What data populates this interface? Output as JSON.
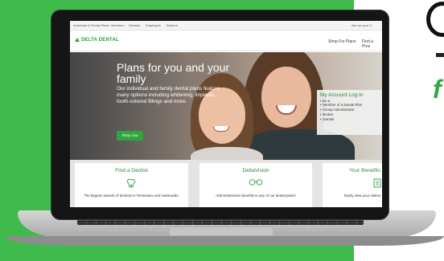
{
  "site": {
    "logo": "DELTA DENTAL",
    "topbar_links": [
      "Individual & Family Plans",
      "Members",
      "Dentists",
      "Employers",
      "Brokers"
    ],
    "topbar_right": "Are we your D",
    "nav": {
      "shop_for_plans": "Shop For Plans",
      "find_a_provider": "Find a Prov"
    }
  },
  "hero": {
    "title": "Plans for you and your family",
    "text": "Our individual and family dental plans feature many options including whitening, implants, tooth-colored fillings and more.",
    "button": "Shop now"
  },
  "account": {
    "title": "My Account Log In",
    "label": "I am a",
    "options": [
      "Member of a Dental Plan",
      "Group Administrator",
      "Broker",
      "Dentist"
    ]
  },
  "cards": [
    {
      "title": "Find a Dentist",
      "icon": "tooth-icon",
      "text": "The largest network of dentists in Tennessee and nationwide."
    },
    {
      "title": "DeltaVision",
      "icon": "glasses-icon",
      "text": "Add DeltaVision benefits to any of our dental plans!"
    },
    {
      "title": "Your Benefits",
      "icon": "document-icon",
      "text": "Easily view your claims"
    }
  ],
  "colors": {
    "brand_green": "#3fba4c",
    "site_green": "#2fa43f"
  }
}
